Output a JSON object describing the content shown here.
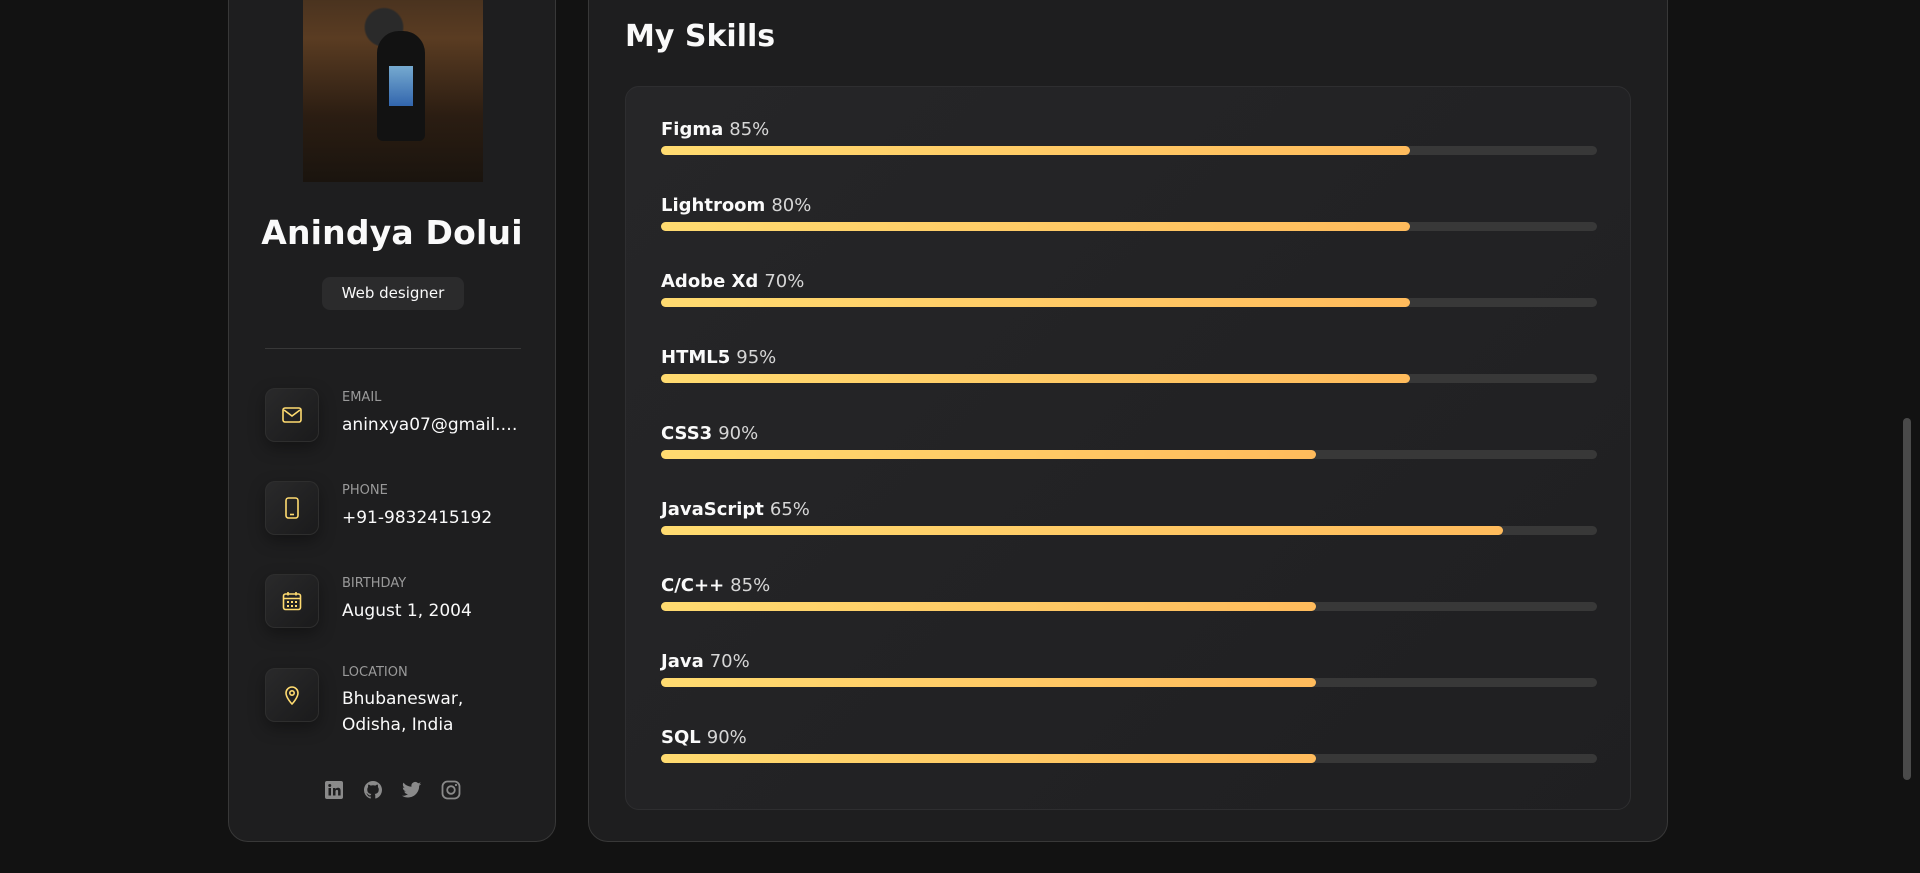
{
  "profile": {
    "name": "Anindya Dolui",
    "title": "Web designer"
  },
  "contacts": [
    {
      "label": "EMAIL",
      "value": "aninxya07@gmail.c...",
      "icon": "mail-icon"
    },
    {
      "label": "PHONE",
      "value": "+91-9832415192",
      "icon": "phone-icon"
    },
    {
      "label": "BIRTHDAY",
      "value": "August 1, 2004",
      "icon": "calendar-icon"
    },
    {
      "label": "LOCATION",
      "value": "Bhubaneswar, Odisha, India",
      "icon": "location-pin-icon"
    }
  ],
  "socials": [
    "linkedin-icon",
    "github-icon",
    "twitter-icon",
    "instagram-icon"
  ],
  "skills_section": {
    "title": "My Skills",
    "items": [
      {
        "name": "Figma",
        "percent": "85%",
        "bar_fill": 0.8
      },
      {
        "name": "Lightroom",
        "percent": "80%",
        "bar_fill": 0.8
      },
      {
        "name": "Adobe Xd",
        "percent": "70%",
        "bar_fill": 0.8
      },
      {
        "name": "HTML5",
        "percent": "95%",
        "bar_fill": 0.8
      },
      {
        "name": "CSS3",
        "percent": "90%",
        "bar_fill": 0.7
      },
      {
        "name": "JavaScript",
        "percent": "65%",
        "bar_fill": 0.9
      },
      {
        "name": "C/C++",
        "percent": "85%",
        "bar_fill": 0.7
      },
      {
        "name": "Java",
        "percent": "70%",
        "bar_fill": 0.7
      },
      {
        "name": "SQL",
        "percent": "90%",
        "bar_fill": 0.7
      }
    ]
  },
  "colors": {
    "accent_start": "#ffdb70",
    "accent_end": "#ffbb5c",
    "background": "#121212",
    "card": "#1e1e1f"
  }
}
